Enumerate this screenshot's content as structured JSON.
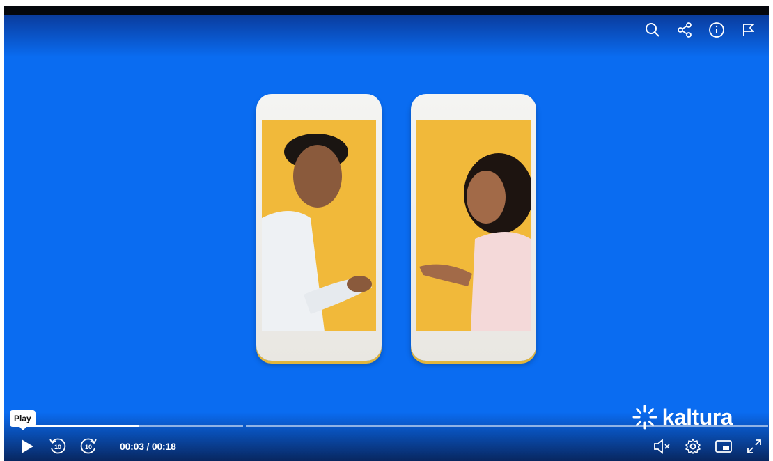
{
  "player": {
    "tooltip": "Play",
    "time": "00:03 / 00:18",
    "progress_fraction": 0.1667,
    "brand": "kaltura",
    "colors": {
      "background": "#0a6cf1",
      "phone_screen": "#f1b93a"
    }
  },
  "top_icons": [
    "search-icon",
    "share-icon",
    "info-icon",
    "flag-icon"
  ],
  "bottom_icons": [
    "play-icon",
    "rewind-10-icon",
    "forward-10-icon",
    "mute-icon",
    "settings-icon",
    "picture-in-picture-icon",
    "fullscreen-icon"
  ],
  "rewind_label": "10",
  "forward_label": "10"
}
